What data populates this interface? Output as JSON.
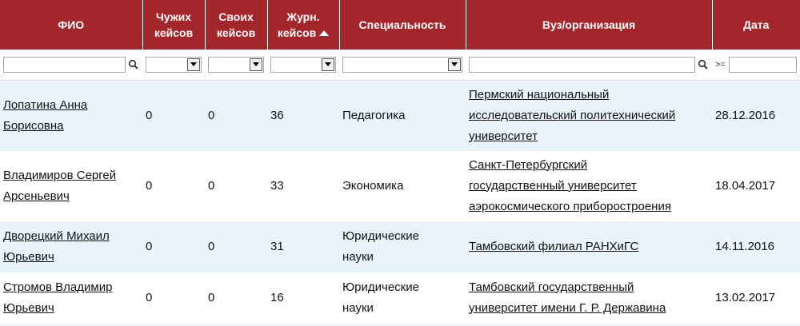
{
  "headers": {
    "name": "ФИО",
    "other_cases_l1": "Чужих",
    "other_cases_l2": "кейсов",
    "own_cases_l1": "Своих",
    "own_cases_l2": "кейсов",
    "journal_cases_l1": "Журн.",
    "journal_cases_l2": "кейсов",
    "specialty": "Специальность",
    "organization": "Вуз/организация",
    "date": "Дата"
  },
  "filters": {
    "name_value": "",
    "other_value": "",
    "own_value": "",
    "journal_value": "",
    "specialty_value": "",
    "organization_value": "",
    "date_operator": ">=",
    "date_value": ""
  },
  "colors": {
    "header_bg": "#a3262b",
    "row_alt_bg": "#e8f4fa"
  },
  "rows": [
    {
      "name_l1": "Лопатина Анна",
      "name_l2": "Борисовна",
      "other": "0",
      "own": "0",
      "journal": "36",
      "specialty_l1": "Педагогика",
      "specialty_l2": "",
      "org_l1": "Пермский национальный",
      "org_l2": "исследовательский политехнический",
      "org_l3": "университет",
      "date": "28.12.2016"
    },
    {
      "name_l1": "Владимиров Сергей",
      "name_l2": "Арсеньевич",
      "other": "0",
      "own": "0",
      "journal": "33",
      "specialty_l1": "Экономика",
      "specialty_l2": "",
      "org_l1": "Санкт-Петербургский",
      "org_l2": "государственный университет",
      "org_l3": "аэрокосмического приборостроения",
      "date": "18.04.2017"
    },
    {
      "name_l1": "Дворецкий Михаил",
      "name_l2": "Юрьевич",
      "other": "0",
      "own": "0",
      "journal": "31",
      "specialty_l1": "Юридические",
      "specialty_l2": "науки",
      "org_l1": "Тамбовский филиал РАНХиГС",
      "org_l2": "",
      "org_l3": "",
      "date": "14.11.2016"
    },
    {
      "name_l1": "Стромов Владимир",
      "name_l2": "Юрьевич",
      "other": "0",
      "own": "0",
      "journal": "16",
      "specialty_l1": "Юридические",
      "specialty_l2": "науки",
      "org_l1": "Тамбовский государственный",
      "org_l2": "университет имени Г. Р. Державина",
      "org_l3": "",
      "date": "13.02.2017"
    }
  ]
}
